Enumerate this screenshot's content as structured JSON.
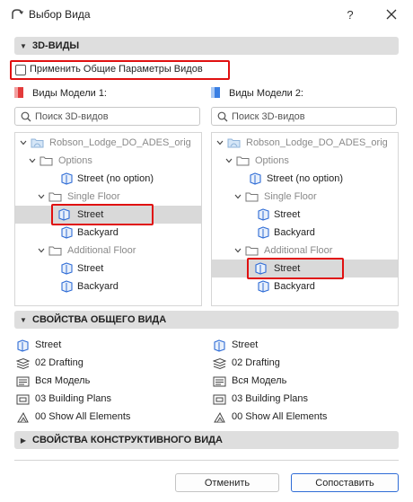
{
  "window": {
    "title": "Выбор Вида",
    "help_label": "?"
  },
  "sections": {
    "views_3d": "3D-ВИДЫ",
    "common_props": "СВОЙСТВА ОБЩЕГО ВИДА",
    "structural_props": "СВОЙСТВА КОНСТРУКТИВНОГО ВИДА"
  },
  "apply_common": {
    "label": "Применить Общие Параметры Видов",
    "checked": false
  },
  "left": {
    "label": "Виды Модели 1:",
    "search_placeholder": "Поиск 3D-видов",
    "flag_color": "#e33a3a",
    "tree": [
      "Robson_Lodge_DO_ADES_orig",
      "Options",
      "Street (no option)",
      "Single Floor",
      "Street",
      "Backyard",
      "Additional Floor",
      "Street",
      "Backyard"
    ],
    "selected_index": 4,
    "props": [
      "Street",
      "02 Drafting",
      "Вся Модель",
      "03 Building Plans",
      "00 Show All Elements"
    ]
  },
  "right": {
    "label": "Виды Модели 2:",
    "search_placeholder": "Поиск 3D-видов",
    "flag_color": "#3a7fe3",
    "tree": [
      "Robson_Lodge_DO_ADES_orig",
      "Options",
      "Street (no option)",
      "Single Floor",
      "Street",
      "Backyard",
      "Additional Floor",
      "Street",
      "Backyard"
    ],
    "selected_index": 7,
    "props": [
      "Street",
      "02 Drafting",
      "Вся Модель",
      "03 Building Plans",
      "00 Show All Elements"
    ]
  },
  "buttons": {
    "cancel": "Отменить",
    "compare": "Сопоставить"
  }
}
